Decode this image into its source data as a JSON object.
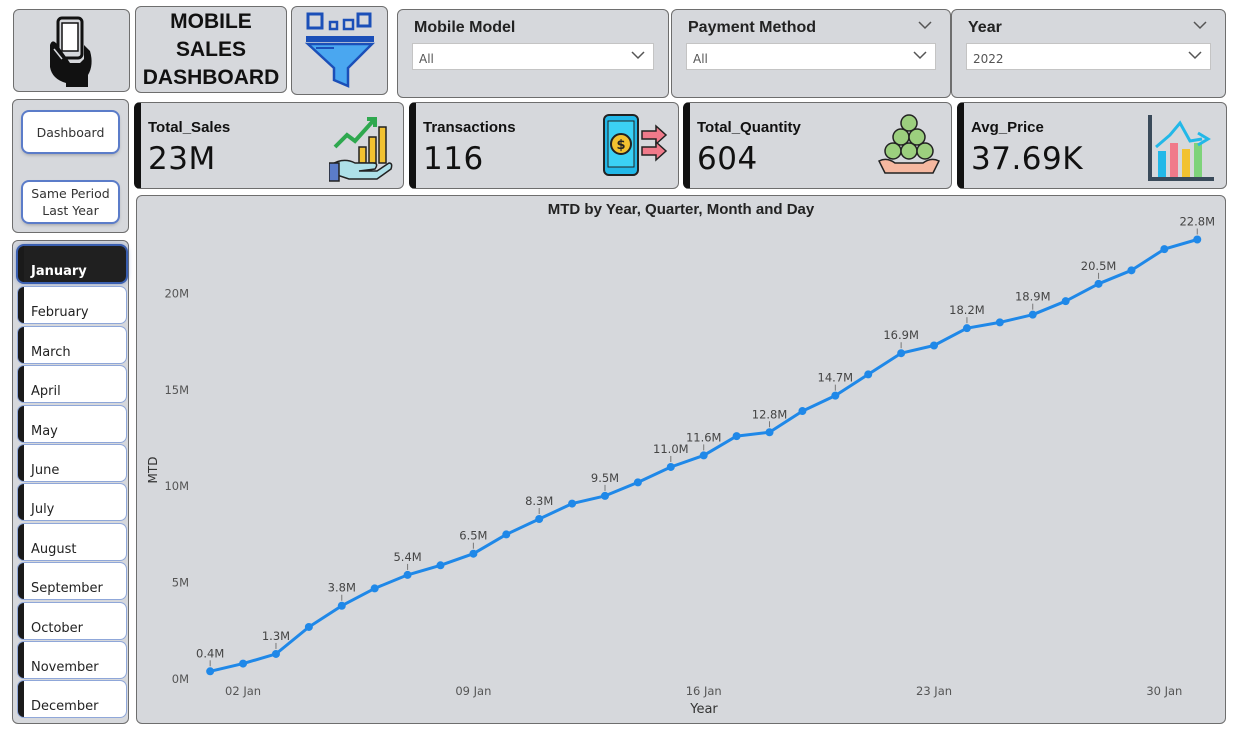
{
  "dashboard": {
    "title_line1": "MOBILE SALES",
    "title_line2": "DASHBOARD"
  },
  "slicers": {
    "mobile_model": {
      "label": "Mobile Model",
      "value": "All"
    },
    "payment_method": {
      "label": "Payment Method",
      "value": "All"
    },
    "year": {
      "label": "Year",
      "value": "2022"
    }
  },
  "nav": {
    "dashboard_label": "Dashboard",
    "same_period_line1": "Same Period",
    "same_period_line2": "Last Year"
  },
  "months": [
    "January",
    "February",
    "March",
    "April",
    "May",
    "June",
    "July",
    "August",
    "September",
    "October",
    "November",
    "December"
  ],
  "active_month": "January",
  "kpis": {
    "total_sales": {
      "label": "Total_Sales",
      "value": "23M"
    },
    "transactions": {
      "label": "Transactions",
      "value": "116"
    },
    "total_quantity": {
      "label": "Total_Quantity",
      "value": "604"
    },
    "avg_price": {
      "label": "Avg_Price",
      "value": "37.69K"
    }
  },
  "icons": {
    "logo": "hand-holding-phone-icon",
    "filter": "filter-funnel-icon",
    "sales": "growth-chart-hand-icon",
    "transactions": "phone-payment-icon",
    "quantity": "coins-pile-hand-icon",
    "price": "bar-chart-icon"
  },
  "colors": {
    "line": "#1f88e8",
    "panel": "#d6d8dc",
    "accent_dark": "#111111"
  },
  "chart_data": {
    "type": "line",
    "title": "MTD by Year, Quarter, Month and Day",
    "xlabel": "Year",
    "ylabel": "MTD",
    "ytick_labels": [
      "0M",
      "5M",
      "10M",
      "15M",
      "20M"
    ],
    "yticks": [
      0,
      5,
      10,
      15,
      20
    ],
    "ylim": [
      0,
      23.5
    ],
    "xtick_labels": [
      "02 Jan",
      "09 Jan",
      "16 Jan",
      "23 Jan",
      "30 Jan"
    ],
    "xticks": [
      2,
      9,
      16,
      23,
      30
    ],
    "xlim": [
      0.6,
      31.6
    ],
    "x": [
      1,
      2,
      3,
      4,
      5,
      6,
      7,
      8,
      9,
      10,
      11,
      12,
      13,
      14,
      15,
      16,
      17,
      18,
      19,
      20,
      21,
      22,
      23,
      24,
      25,
      26,
      27,
      28,
      29,
      30,
      31
    ],
    "values": [
      0.4,
      0.8,
      1.3,
      2.7,
      3.8,
      4.7,
      5.4,
      5.9,
      6.5,
      7.5,
      8.3,
      9.1,
      9.5,
      10.2,
      11.0,
      11.6,
      12.6,
      12.8,
      13.9,
      14.7,
      15.8,
      16.9,
      17.3,
      18.2,
      18.5,
      18.9,
      19.6,
      20.5,
      21.2,
      22.3,
      22.8
    ],
    "data_labels": {
      "1": "0.4M",
      "3": "1.3M",
      "5": "3.8M",
      "7": "5.4M",
      "9": "6.5M",
      "11": "8.3M",
      "13": "9.5M",
      "15": "11.0M",
      "16": "11.6M",
      "18": "12.8M",
      "20": "14.7M",
      "22": "16.9M",
      "24": "18.2M",
      "26": "18.9M",
      "28": "20.5M",
      "31": "22.8M"
    },
    "grid": false,
    "legend": "none"
  }
}
